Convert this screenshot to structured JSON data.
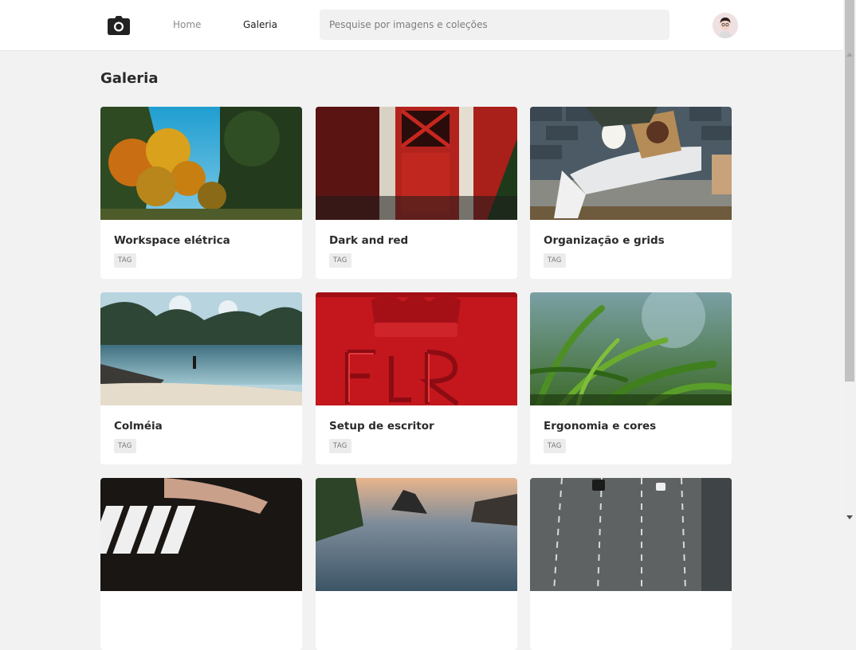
{
  "nav": {
    "home_label": "Home",
    "galeria_label": "Galeria",
    "logo_icon": "camera-icon"
  },
  "search": {
    "placeholder": "Pesquise por imagens e coleções",
    "value": ""
  },
  "page": {
    "title": "Galeria"
  },
  "cards": [
    {
      "title": "Workspace elétrica",
      "tag": "TAG",
      "image": "autumn-trees-photo"
    },
    {
      "title": "Dark and red",
      "tag": "TAG",
      "image": "red-barn-door-photo"
    },
    {
      "title": "Organização e grids",
      "tag": "TAG",
      "image": "person-coffee-photo"
    },
    {
      "title": "Colméia",
      "tag": "TAG",
      "image": "beach-mountains-photo"
    },
    {
      "title": "Setup de escritor",
      "tag": "TAG",
      "image": "red-postbox-photo"
    },
    {
      "title": "Ergonomia e cores",
      "tag": "TAG",
      "image": "grass-closeup-photo"
    },
    {
      "title": "",
      "tag": "",
      "image": "piano-keys-photo"
    },
    {
      "title": "",
      "tag": "",
      "image": "sunset-rocks-photo"
    },
    {
      "title": "",
      "tag": "",
      "image": "highway-aerial-photo"
    }
  ],
  "colors": {
    "background": "#f2f2f2",
    "card": "#ffffff",
    "tag_bg": "#ececec"
  }
}
